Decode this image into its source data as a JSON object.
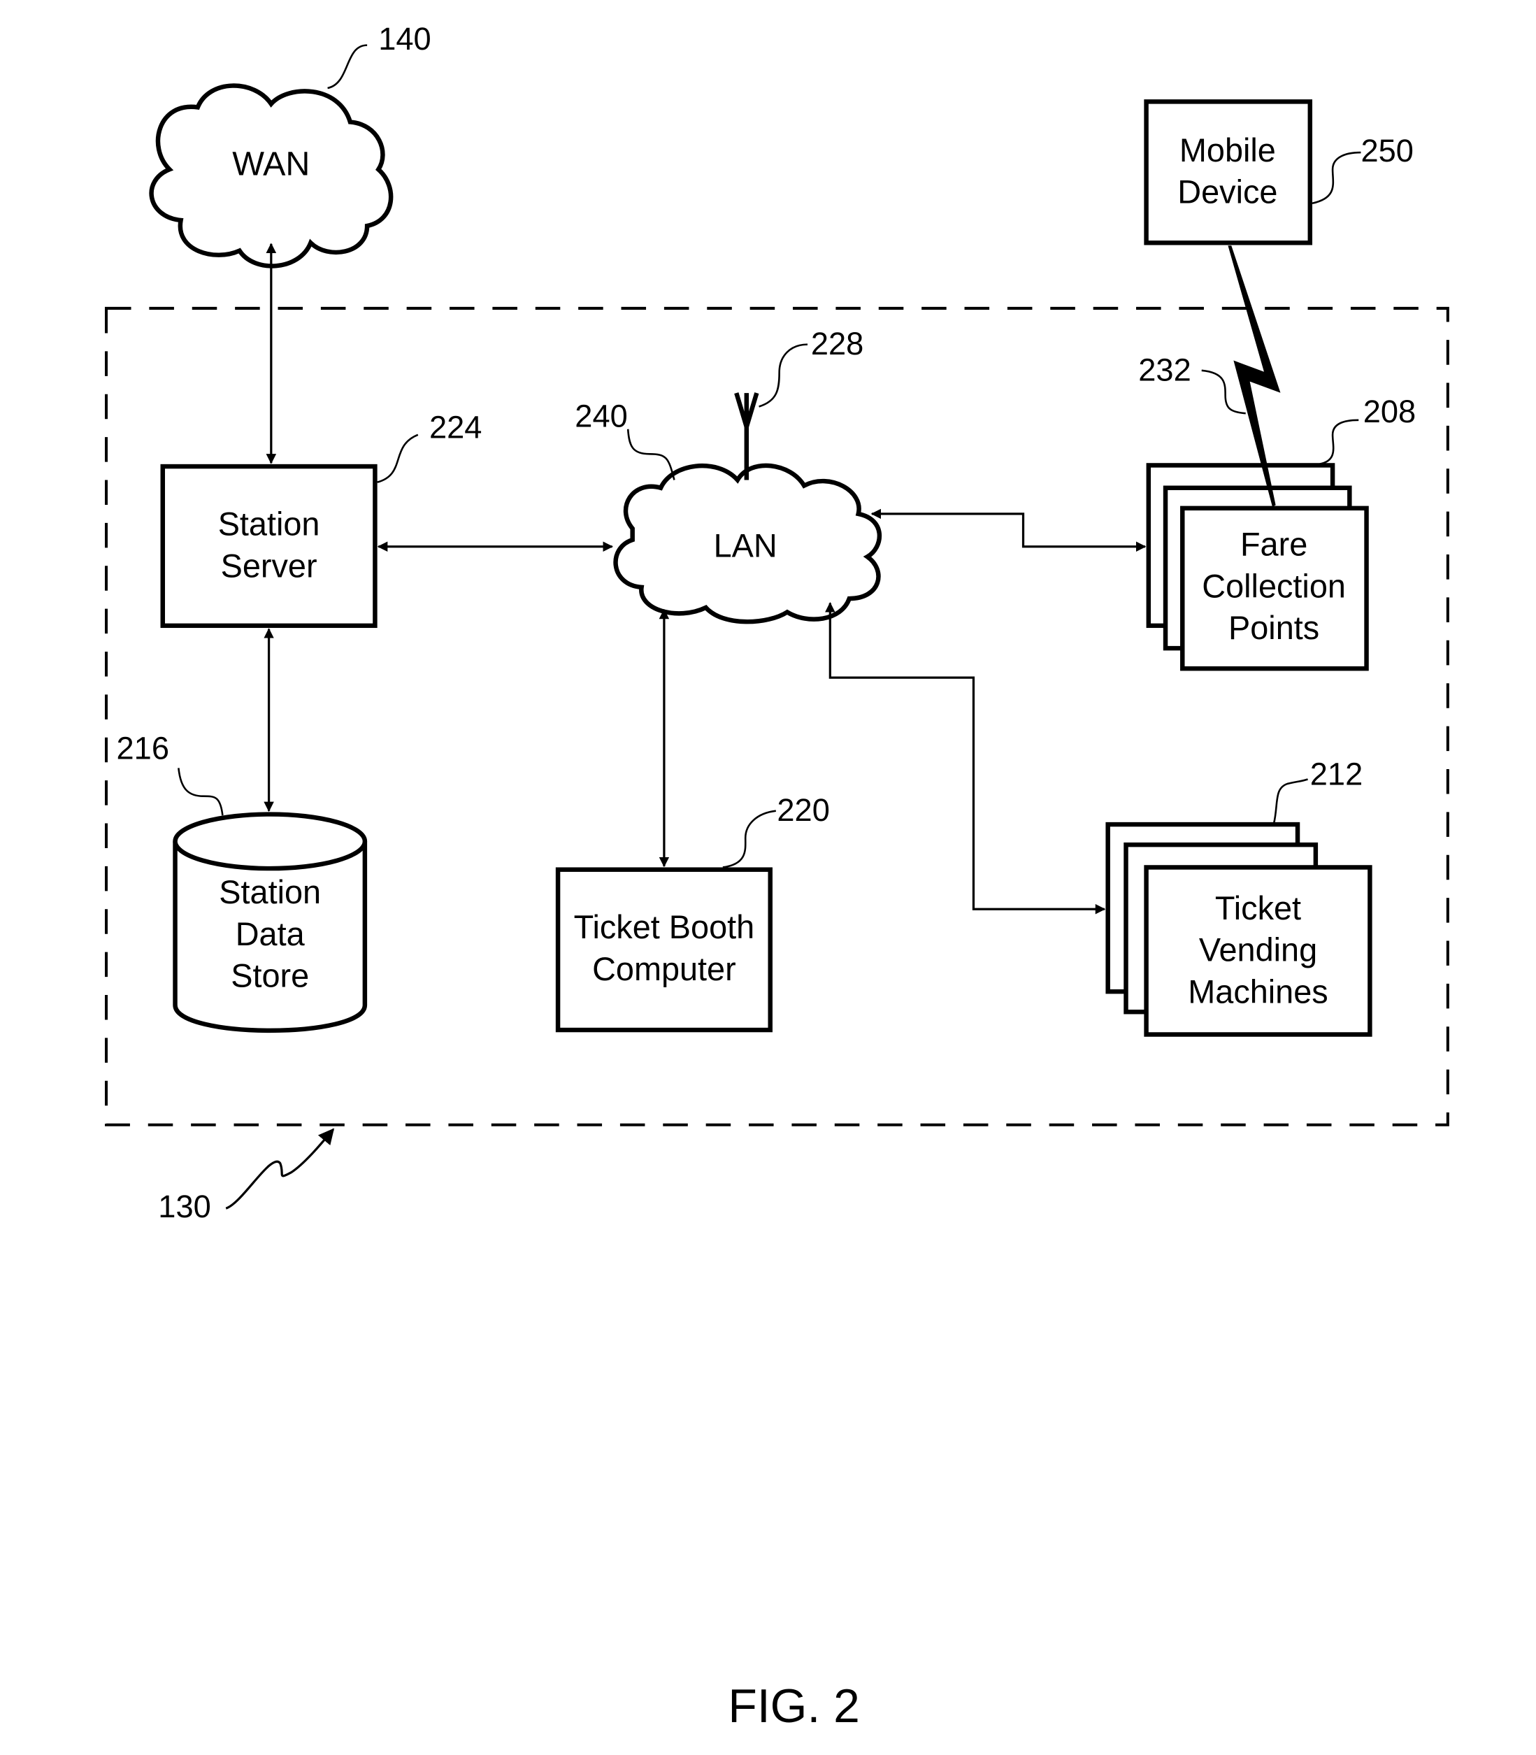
{
  "figure": {
    "caption": "FIG. 2",
    "system_ref": "130",
    "colors": {
      "stroke": "#000000",
      "background": "#ffffff"
    }
  },
  "nodes": {
    "wan": {
      "label": "WAN",
      "ref": "140"
    },
    "station_server": {
      "lines": [
        "Station",
        "Server"
      ],
      "ref": "224"
    },
    "lan": {
      "label": "LAN",
      "ref": "240"
    },
    "antenna": {
      "ref": "228"
    },
    "mobile_device": {
      "lines": [
        "Mobile",
        "Device"
      ],
      "ref": "250"
    },
    "wireless_link": {
      "ref": "232"
    },
    "fare_collection": {
      "lines": [
        "Fare",
        "Collection",
        "Points"
      ],
      "ref": "208"
    },
    "station_data_store": {
      "lines": [
        "Station",
        "Data",
        "Store"
      ],
      "ref": "216"
    },
    "ticket_booth": {
      "lines": [
        "Ticket Booth",
        "Computer"
      ],
      "ref": "220"
    },
    "ticket_vending": {
      "lines": [
        "Ticket",
        "Vending",
        "Machines"
      ],
      "ref": "212"
    }
  },
  "connections": [
    {
      "from": "WAN",
      "to": "Station Server",
      "direction": "bidirectional"
    },
    {
      "from": "Station Server",
      "to": "LAN",
      "direction": "bidirectional"
    },
    {
      "from": "Station Server",
      "to": "Station Data Store",
      "direction": "bidirectional"
    },
    {
      "from": "LAN",
      "to": "Ticket Booth Computer",
      "direction": "bidirectional"
    },
    {
      "from": "LAN",
      "to": "Fare Collection Points",
      "direction": "bidirectional"
    },
    {
      "from": "LAN",
      "to": "Ticket Vending Machines",
      "direction": "bidirectional"
    },
    {
      "from": "Mobile Device",
      "to": "Fare Collection Points",
      "direction": "wireless"
    }
  ]
}
